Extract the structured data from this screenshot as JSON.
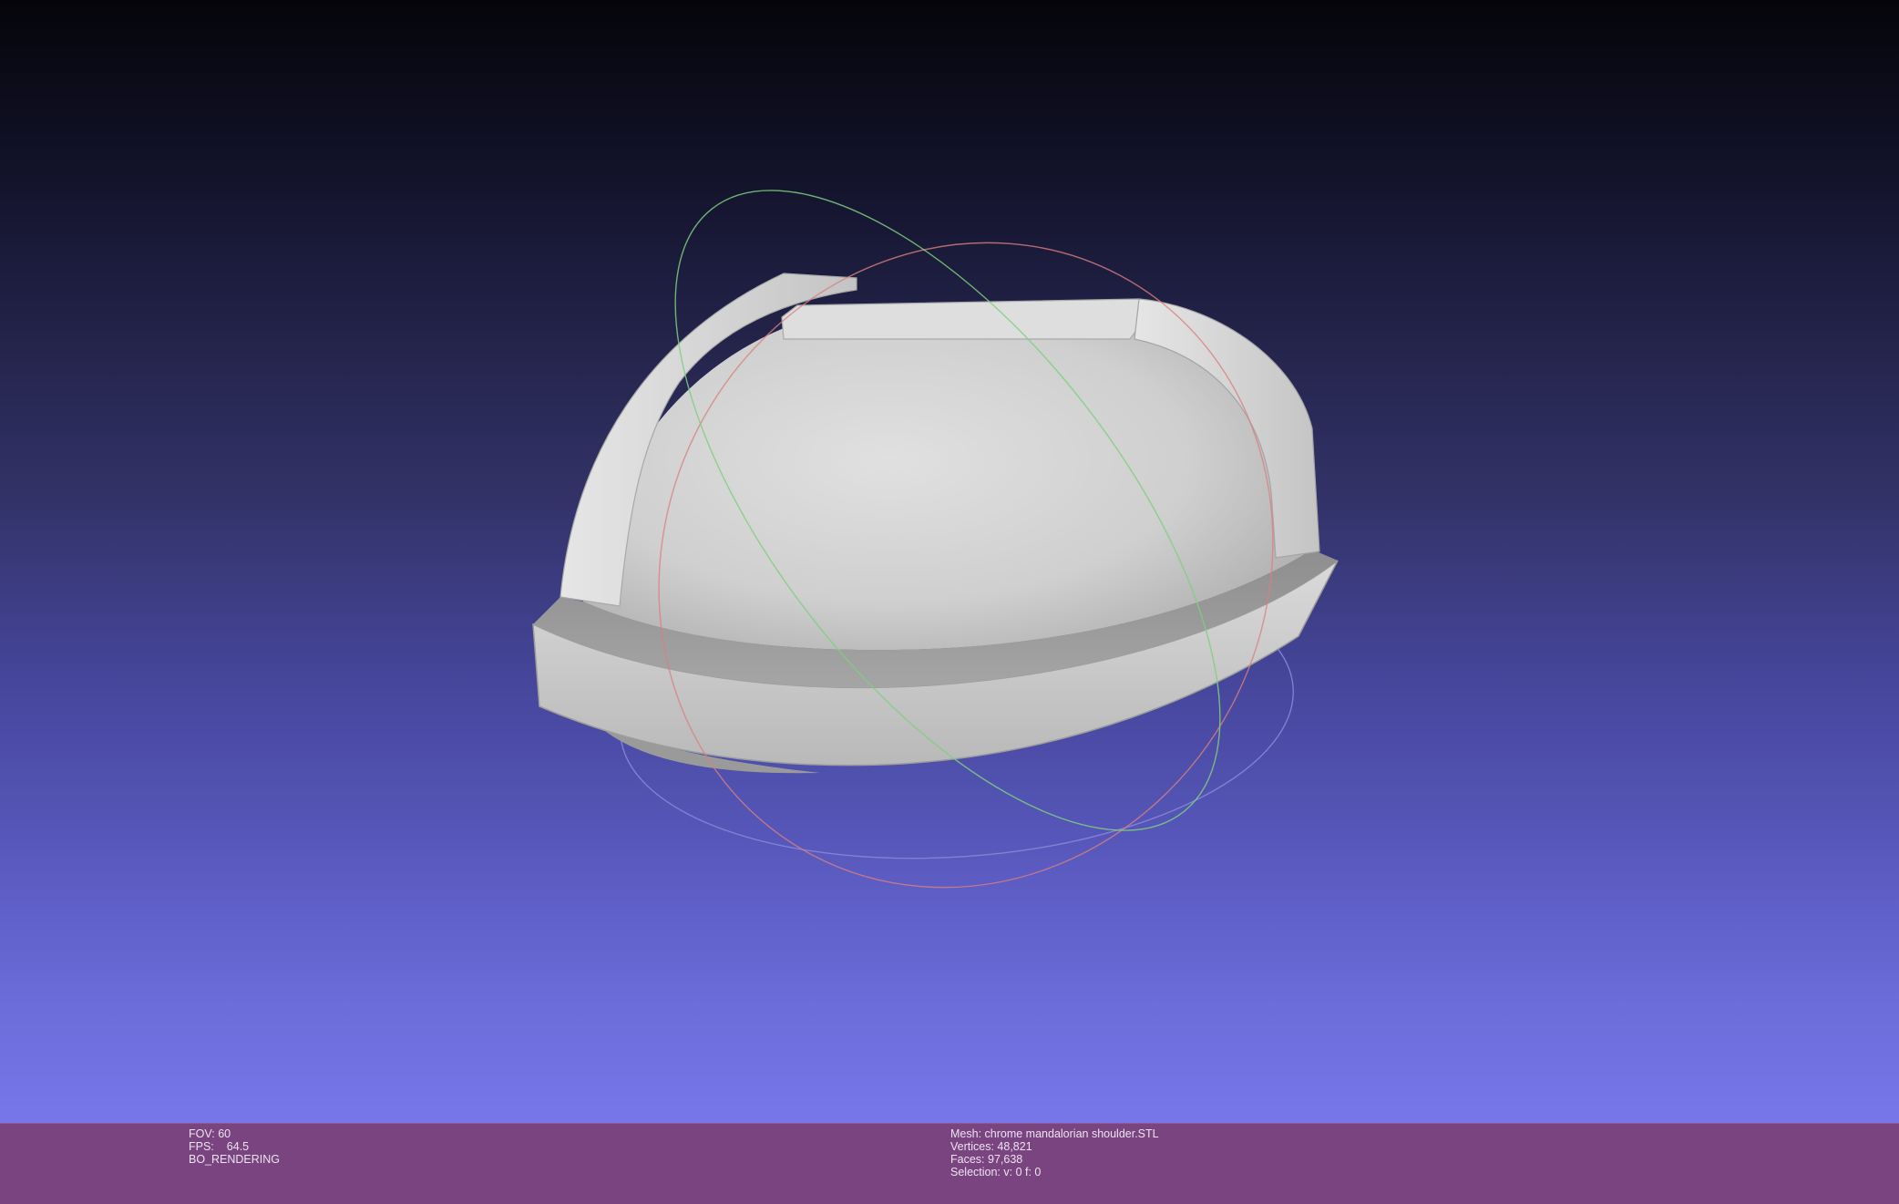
{
  "status": {
    "fov_label": "FOV:",
    "fov_value": "60",
    "fps_label": "FPS:",
    "fps_value": "64.5",
    "render_mode": "BO_RENDERING",
    "mesh_label": "Mesh:",
    "mesh_name": "chrome mandalorian shoulder.STL",
    "vertices_label": "Vertices:",
    "vertices_value": "48,821",
    "faces_label": "Faces:",
    "faces_value": "97,638",
    "selection_label": "Selection:",
    "selection_value": "v: 0 f: 0"
  },
  "colors": {
    "background_top": "#050509",
    "background_bottom": "#7777ea",
    "status_bar": "#7a4480",
    "model_surface": "#c8c8c8",
    "trackball_x": "#d98080",
    "trackball_y": "#7fcf7f",
    "trackball_z": "#8a8ad8"
  },
  "viewer": {
    "object": "shoulder-armor-mesh",
    "gizmo": "trackball"
  }
}
